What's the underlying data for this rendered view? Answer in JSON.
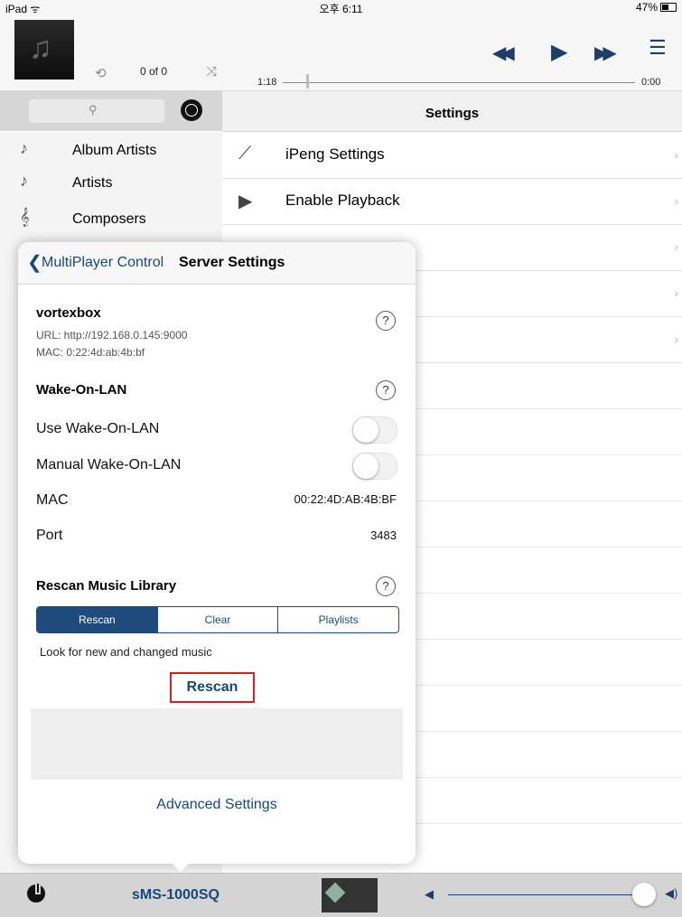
{
  "status": {
    "device": "iPad",
    "time": "오후 6:11",
    "battery": "47%"
  },
  "nowplaying": {
    "track_count": "0 of 0",
    "elapsed": "1:18",
    "remaining": "0:00",
    "progress_fraction": 0.07
  },
  "settings_header": {
    "title": "Settings"
  },
  "library": [
    {
      "label": "Album Artists",
      "icon": "album-artists-icon"
    },
    {
      "label": "Artists",
      "icon": "artists-icon"
    },
    {
      "label": "Composers",
      "icon": "composers-icon"
    }
  ],
  "settings_list": [
    {
      "label": "iPeng Settings",
      "icon": "ipeng-icon"
    },
    {
      "label": "Enable Playback",
      "icon": "playback-icon"
    }
  ],
  "popover": {
    "back_label": "MultiPlayer Control",
    "title": "Server Settings",
    "server": {
      "name": "vortexbox",
      "url": "URL: http://192.168.0.145:9000",
      "mac": "MAC: 0:22:4d:ab:4b:bf"
    },
    "wol": {
      "title": "Wake-On-LAN",
      "use_label": "Use Wake-On-LAN",
      "manual_label": "Manual Wake-On-LAN",
      "mac_label": "MAC",
      "mac_value": "00:22:4D:AB:4B:BF",
      "port_label": "Port",
      "port_value": "3483"
    },
    "rescan": {
      "title": "Rescan Music Library",
      "segments": [
        "Rescan",
        "Clear",
        "Playlists"
      ],
      "selected": "Rescan",
      "description": "Look for new and changed music",
      "button": "Rescan"
    },
    "advanced": "Advanced Settings"
  },
  "bottom": {
    "player_name": "sMS-1000SQ",
    "volume_fraction": 0.94
  }
}
